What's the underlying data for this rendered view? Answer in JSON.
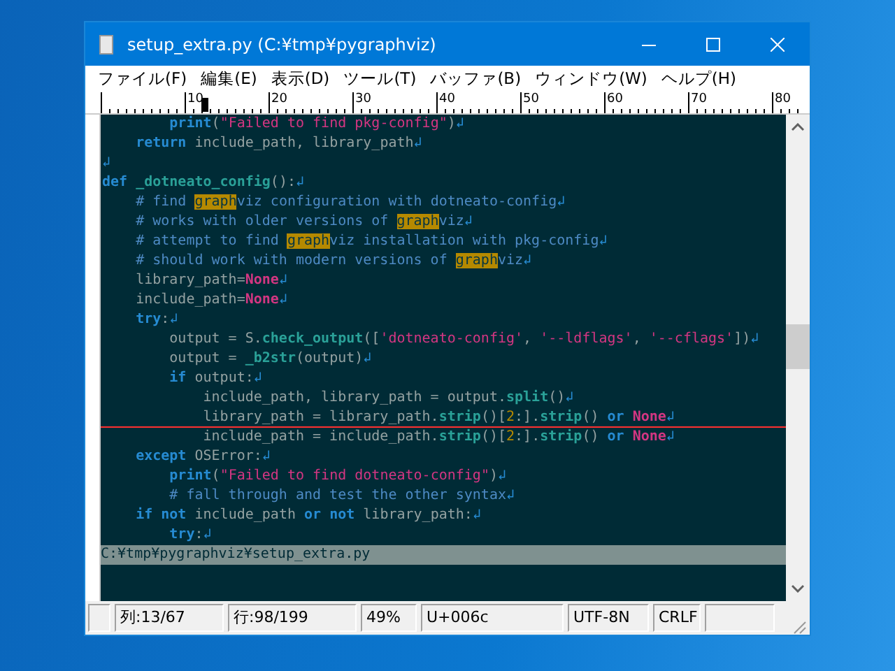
{
  "window": {
    "title": "setup_extra.py (C:¥tmp¥pygraphviz)"
  },
  "menu": [
    "ファイル(F)",
    "編集(E)",
    "表示(D)",
    "ツール(T)",
    "バッファ(B)",
    "ウィンドウ(W)",
    "ヘルプ(H)"
  ],
  "ruler": {
    "labels": [
      "10",
      "20",
      "30",
      "40",
      "50",
      "60",
      "70",
      "80"
    ],
    "level": 0.15
  },
  "code_lines": [
    {
      "cursor_line": false,
      "tokens": [
        {
          "kind": "kw",
          "text": "        print"
        },
        {
          "kind": "plain",
          "text": "("
        },
        {
          "kind": "str",
          "text": "\"Failed to find pkg-config\""
        },
        {
          "kind": "plain",
          "text": ")"
        },
        {
          "kind": "eol",
          "text": "↲"
        }
      ]
    },
    {
      "cursor_line": false,
      "tokens": [
        {
          "kind": "kw",
          "text": "    return"
        },
        {
          "kind": "plain",
          "text": " include_path, library_path"
        },
        {
          "kind": "eol",
          "text": "↲"
        }
      ]
    },
    {
      "cursor_line": false,
      "tokens": [
        {
          "kind": "eol",
          "text": "↲"
        }
      ]
    },
    {
      "cursor_line": false,
      "tokens": [
        {
          "kind": "kw",
          "text": "def"
        },
        {
          "kind": "fn",
          "text": " _dotneato_config"
        },
        {
          "kind": "plain",
          "text": "():"
        },
        {
          "kind": "eol",
          "text": "↲"
        }
      ]
    },
    {
      "cursor_line": false,
      "tokens": [
        {
          "kind": "cm",
          "text": "    # find "
        },
        {
          "kind": "hl",
          "text": "graph"
        },
        {
          "kind": "cm",
          "text": "viz configuration with dotneato-config"
        },
        {
          "kind": "eol",
          "text": "↲"
        }
      ]
    },
    {
      "cursor_line": false,
      "tokens": [
        {
          "kind": "cm",
          "text": "    # works with older versions of "
        },
        {
          "kind": "hl",
          "text": "graph"
        },
        {
          "kind": "cm",
          "text": "viz"
        },
        {
          "kind": "eol",
          "text": "↲"
        }
      ]
    },
    {
      "cursor_line": false,
      "tokens": [
        {
          "kind": "cm",
          "text": "    # attempt to find "
        },
        {
          "kind": "hl",
          "text": "graph"
        },
        {
          "kind": "cm",
          "text": "viz installation with pkg-config"
        },
        {
          "kind": "eol",
          "text": "↲"
        }
      ]
    },
    {
      "cursor_line": false,
      "tokens": [
        {
          "kind": "cm",
          "text": "    # should work with modern versions of "
        },
        {
          "kind": "hl",
          "text": "graph"
        },
        {
          "kind": "cm",
          "text": "viz"
        },
        {
          "kind": "eol",
          "text": "↲"
        }
      ]
    },
    {
      "cursor_line": false,
      "tokens": [
        {
          "kind": "plain",
          "text": "    library_path="
        },
        {
          "kind": "none",
          "text": "None"
        },
        {
          "kind": "eol",
          "text": "↲"
        }
      ]
    },
    {
      "cursor_line": false,
      "tokens": [
        {
          "kind": "plain",
          "text": "    include_path="
        },
        {
          "kind": "none",
          "text": "None"
        },
        {
          "kind": "eol",
          "text": "↲"
        }
      ]
    },
    {
      "cursor_line": false,
      "tokens": [
        {
          "kind": "kw",
          "text": "    try"
        },
        {
          "kind": "plain",
          "text": ":"
        },
        {
          "kind": "eol",
          "text": "↲"
        }
      ]
    },
    {
      "cursor_line": false,
      "tokens": [
        {
          "kind": "plain",
          "text": "        output = S."
        },
        {
          "kind": "fn",
          "text": "check_output"
        },
        {
          "kind": "plain",
          "text": "(["
        },
        {
          "kind": "str",
          "text": "'dotneato-config'"
        },
        {
          "kind": "plain",
          "text": ", "
        },
        {
          "kind": "str",
          "text": "'--ldflags'"
        },
        {
          "kind": "plain",
          "text": ", "
        },
        {
          "kind": "str",
          "text": "'--cflags'"
        },
        {
          "kind": "plain",
          "text": "])"
        },
        {
          "kind": "eol",
          "text": "↲"
        }
      ]
    },
    {
      "cursor_line": false,
      "tokens": [
        {
          "kind": "plain",
          "text": "        output = "
        },
        {
          "kind": "fn",
          "text": "_b2str"
        },
        {
          "kind": "plain",
          "text": "(output)"
        },
        {
          "kind": "eol",
          "text": "↲"
        }
      ]
    },
    {
      "cursor_line": false,
      "tokens": [
        {
          "kind": "kw",
          "text": "        if"
        },
        {
          "kind": "plain",
          "text": " output:"
        },
        {
          "kind": "eol",
          "text": "↲"
        }
      ]
    },
    {
      "cursor_line": false,
      "tokens": [
        {
          "kind": "plain",
          "text": "            include_path, library_path = output."
        },
        {
          "kind": "fn",
          "text": "split"
        },
        {
          "kind": "plain",
          "text": "()"
        },
        {
          "kind": "eol",
          "text": "↲"
        }
      ]
    },
    {
      "cursor_line": true,
      "tokens": [
        {
          "kind": "plain",
          "text": "            library_path = library_path."
        },
        {
          "kind": "fn",
          "text": "strip"
        },
        {
          "kind": "plain",
          "text": "()["
        },
        {
          "kind": "num",
          "text": "2"
        },
        {
          "kind": "plain",
          "text": ":]."
        },
        {
          "kind": "fn",
          "text": "strip"
        },
        {
          "kind": "plain",
          "text": "() "
        },
        {
          "kind": "kw",
          "text": "or "
        },
        {
          "kind": "none",
          "text": "None"
        },
        {
          "kind": "eol",
          "text": "↲"
        }
      ]
    },
    {
      "cursor_line": false,
      "tokens": [
        {
          "kind": "plain",
          "text": "            include_path = include_path."
        },
        {
          "kind": "fn",
          "text": "strip"
        },
        {
          "kind": "plain",
          "text": "()["
        },
        {
          "kind": "num",
          "text": "2"
        },
        {
          "kind": "plain",
          "text": ":]."
        },
        {
          "kind": "fn",
          "text": "strip"
        },
        {
          "kind": "plain",
          "text": "() "
        },
        {
          "kind": "kw",
          "text": "or "
        },
        {
          "kind": "none",
          "text": "None"
        },
        {
          "kind": "eol",
          "text": "↲"
        }
      ]
    },
    {
      "cursor_line": false,
      "tokens": [
        {
          "kind": "kw",
          "text": "    except"
        },
        {
          "kind": "plain",
          "text": " OSError:"
        },
        {
          "kind": "eol",
          "text": "↲"
        }
      ]
    },
    {
      "cursor_line": false,
      "tokens": [
        {
          "kind": "kw",
          "text": "        print"
        },
        {
          "kind": "plain",
          "text": "("
        },
        {
          "kind": "str",
          "text": "\"Failed to find dotneato-config\""
        },
        {
          "kind": "plain",
          "text": ")"
        },
        {
          "kind": "eol",
          "text": "↲"
        }
      ]
    },
    {
      "cursor_line": false,
      "tokens": [
        {
          "kind": "cm",
          "text": "        # fall through and test the other syntax"
        },
        {
          "kind": "eol",
          "text": "↲"
        }
      ]
    },
    {
      "cursor_line": false,
      "tokens": [
        {
          "kind": "kw",
          "text": "    if not"
        },
        {
          "kind": "plain",
          "text": " include_path "
        },
        {
          "kind": "kw",
          "text": "or not"
        },
        {
          "kind": "plain",
          "text": " library_path:"
        },
        {
          "kind": "eol",
          "text": "↲"
        }
      ]
    },
    {
      "cursor_line": false,
      "tokens": [
        {
          "kind": "kw",
          "text": "        try"
        },
        {
          "kind": "plain",
          "text": ":"
        },
        {
          "kind": "eol",
          "text": "↲"
        }
      ]
    }
  ],
  "path_bar": "C:¥tmp¥pygraphviz¥setup_extra.py",
  "status_bar": [
    "列:13/67",
    "行:98/199",
    "49%",
    "U+006c",
    "UTF-8N",
    "CRLF"
  ]
}
